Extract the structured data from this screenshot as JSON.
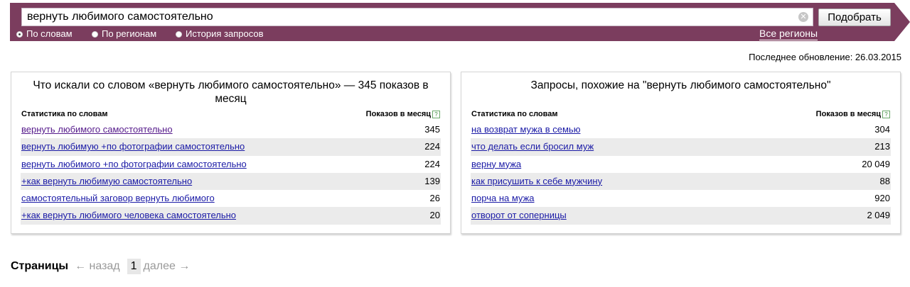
{
  "search": {
    "query": "вернуть любимого самостоятельно",
    "submit_label": "Подобрать",
    "clear_glyph": "✕"
  },
  "modes": {
    "by_words": "По словам",
    "by_regions": "По регионам",
    "history": "История запросов",
    "selected": "by_words"
  },
  "regions_link": "Все регионы",
  "last_update": "Последнее обновление: 26.03.2015",
  "colors": {
    "band": "#7b3d5e",
    "link": "#1a1aa6",
    "visited_link": "#551a8b",
    "row_shade": "#ebebeb"
  },
  "left_panel": {
    "title": "Что искали со словом «вернуть любимого самостоятельно» — 345 показов в месяц",
    "col_words": "Статистика по словам",
    "col_shows": "Показов в месяц",
    "rows": [
      {
        "phrase": "вернуть любимого самостоятельно",
        "count": "345"
      },
      {
        "phrase": "вернуть любимую +по фотографии самостоятельно",
        "count": "224"
      },
      {
        "phrase": "вернуть любимого +по фотографии самостоятельно",
        "count": "224"
      },
      {
        "phrase": "+как вернуть любимую самостоятельно",
        "count": "139"
      },
      {
        "phrase": "самостоятельный заговор вернуть любимого",
        "count": "26"
      },
      {
        "phrase": "+как вернуть любимого человека самостоятельно",
        "count": "20"
      }
    ]
  },
  "right_panel": {
    "title": "Запросы, похожие на \"вернуть любимого самостоятельно\"",
    "col_words": "Статистика по словам",
    "col_shows": "Показов в месяц",
    "rows": [
      {
        "phrase": "на возврат мужа в семью",
        "count": "304"
      },
      {
        "phrase": "что делать если бросил муж",
        "count": "213"
      },
      {
        "phrase": "верну мужа",
        "count": "20 049"
      },
      {
        "phrase": "как присушить к себе мужчину",
        "count": "88"
      },
      {
        "phrase": "порча на мужа",
        "count": "920"
      },
      {
        "phrase": "отворот от соперницы",
        "count": "2 049"
      }
    ]
  },
  "help_glyph": "?",
  "pagination": {
    "label": "Страницы",
    "prev": "← назад",
    "current": "1",
    "next": "далее →"
  }
}
